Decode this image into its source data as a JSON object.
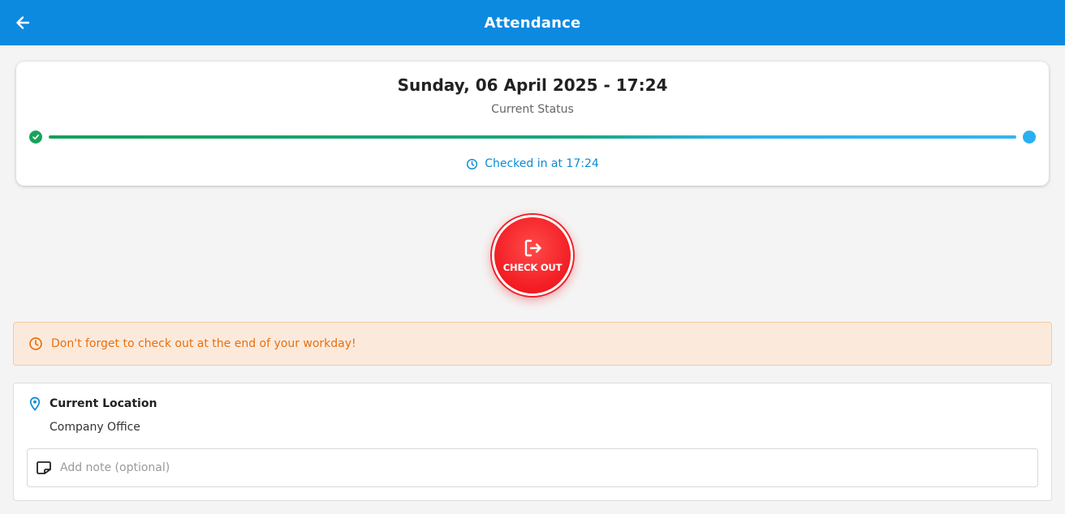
{
  "app_bar": {
    "title": "Attendance",
    "back_icon": "arrow-left-icon",
    "background": "#0b8ae0"
  },
  "status_card": {
    "date_time": "Sunday, 06 April 2025 - 17:24",
    "status_label": "Current Status",
    "progress": {
      "start_icon": "check-circle-icon",
      "end_icon": "dot-icon",
      "start_color": "#1aa25a",
      "end_color": "#29b0f0"
    },
    "checkin_icon": "clock-icon",
    "checkin_text": "Checked in at 17:24"
  },
  "checkout_button": {
    "label": "CHECK OUT",
    "icon": "logout-icon",
    "color": "#f21c22"
  },
  "reminder": {
    "icon": "clock-icon",
    "text": "Don't forget to check out at the end of your workday!",
    "color": "#ea6f0c"
  },
  "location": {
    "icon": "map-pin-icon",
    "title": "Current Location",
    "value": "Company Office"
  },
  "note": {
    "icon": "note-icon",
    "value": "",
    "placeholder": "Add note (optional)"
  }
}
